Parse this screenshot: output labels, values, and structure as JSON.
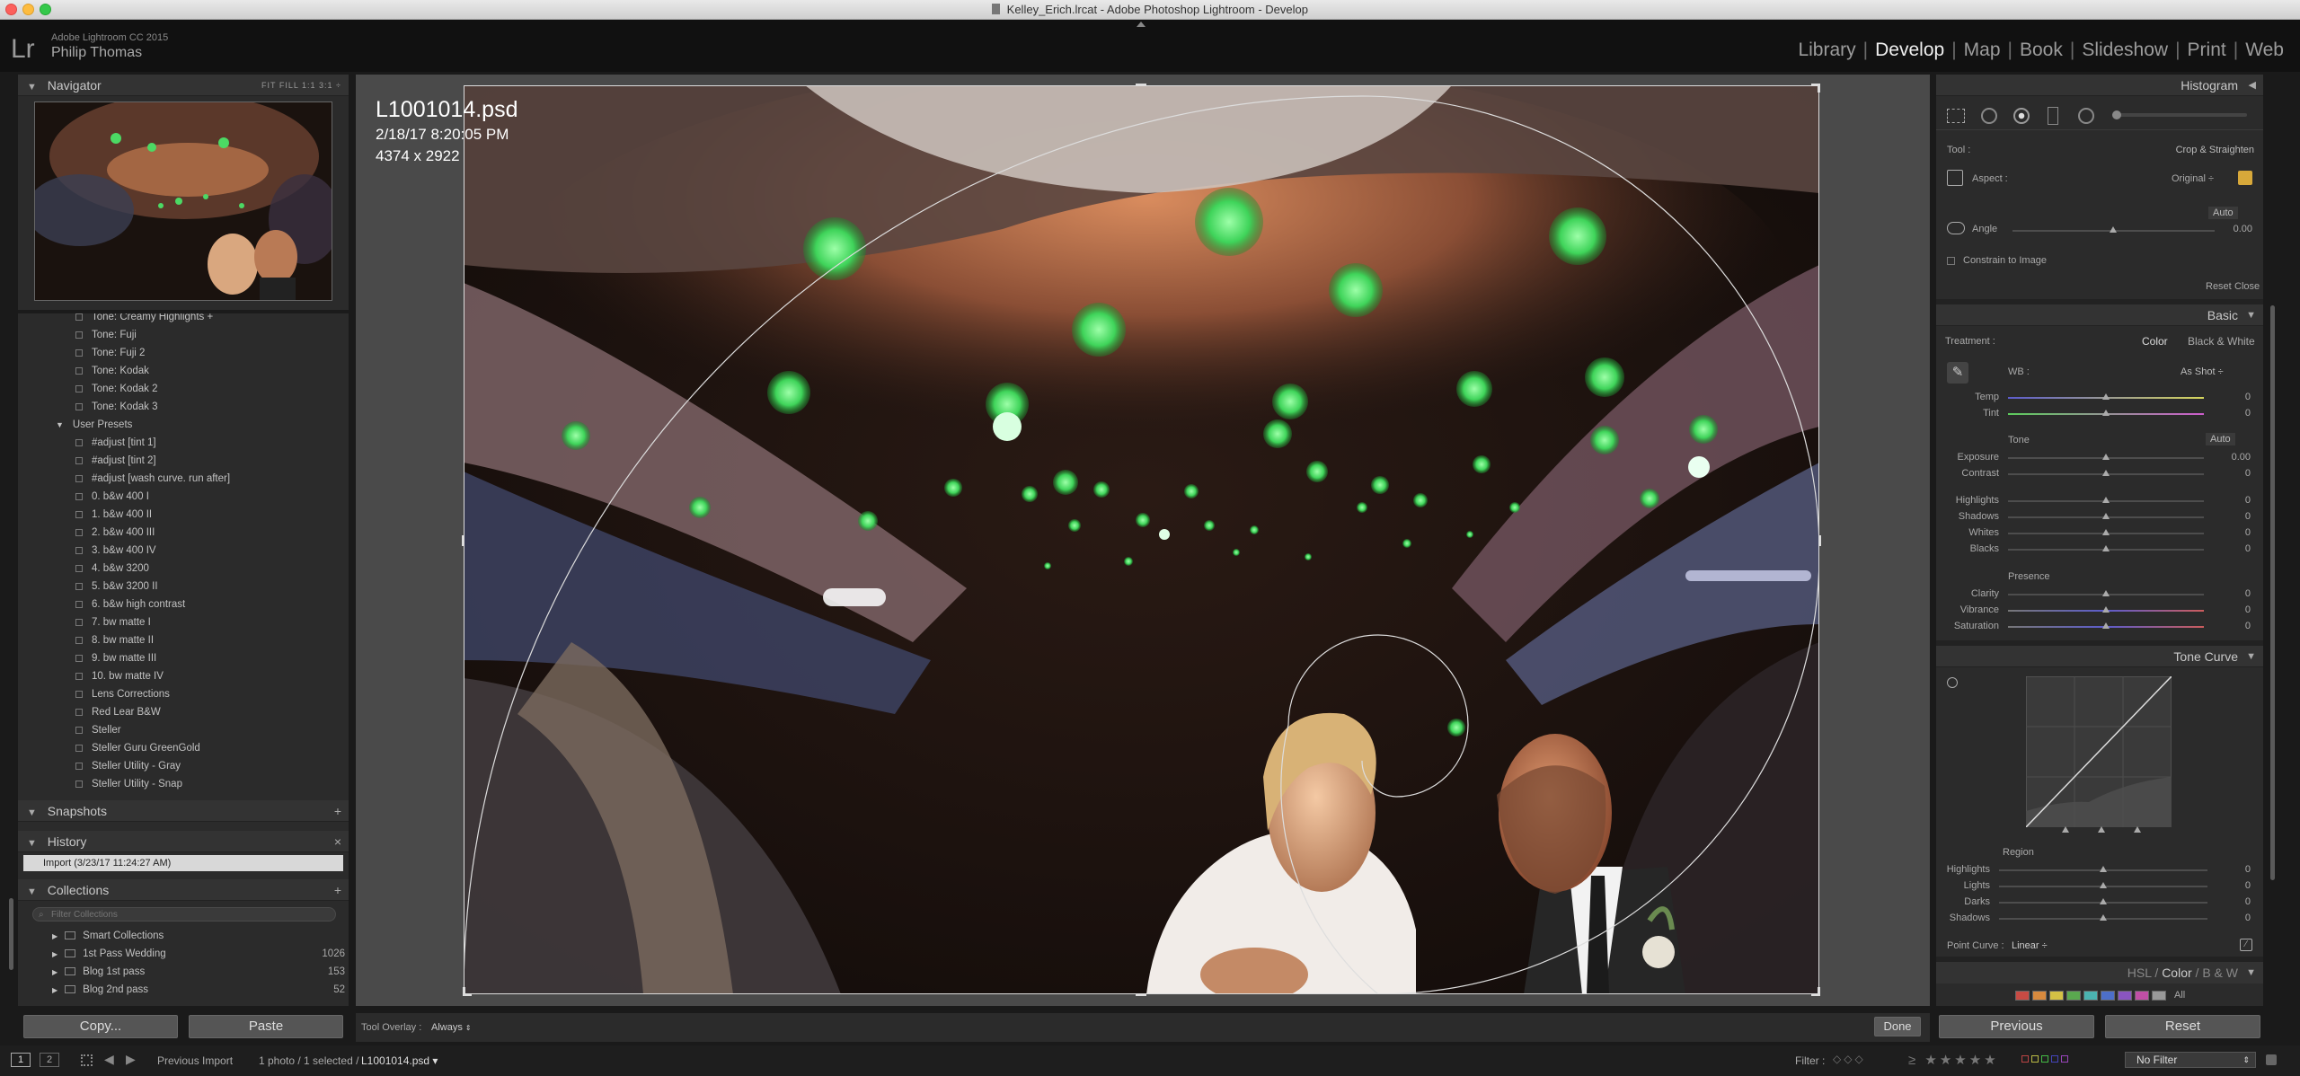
{
  "window": {
    "title": "Kelley_Erich.lrcat - Adobe Photoshop Lightroom - Develop"
  },
  "identity": {
    "logo": "Lr",
    "app_name": "Adobe Lightroom CC 2015",
    "user": "Philip Thomas"
  },
  "modules": [
    {
      "label": "Library",
      "active": false
    },
    {
      "label": "Develop",
      "active": true
    },
    {
      "label": "Map",
      "active": false
    },
    {
      "label": "Book",
      "active": false
    },
    {
      "label": "Slideshow",
      "active": false
    },
    {
      "label": "Print",
      "active": false
    },
    {
      "label": "Web",
      "active": false
    }
  ],
  "navigator": {
    "title": "Navigator",
    "modes": "FIT  FILL  1:1  3:1 ÷"
  },
  "presets": {
    "items": [
      "Tone: Creamy Highlights +",
      "Tone: Fuji",
      "Tone: Fuji 2",
      "Tone: Kodak",
      "Tone: Kodak 2",
      "Tone: Kodak 3"
    ],
    "user_folder": "User Presets",
    "user_items": [
      "#adjust [tint 1]",
      "#adjust [tint 2]",
      "#adjust [wash curve. run after]",
      "0. b&w 400 I",
      "1. b&w 400 II",
      "2. b&w 400 III",
      "3. b&w 400 IV",
      "4. b&w 3200",
      "5. b&w 3200 II",
      "6. b&w high contrast",
      "7. bw matte I",
      "8. bw matte II",
      "9. bw matte III",
      "10. bw matte IV",
      "Lens Corrections",
      "Red Lear B&W",
      "Steller",
      "Steller Guru GreenGold",
      "Steller Utility - Gray",
      "Steller Utility - Snap"
    ]
  },
  "snapshots": {
    "title": "Snapshots",
    "action": "+"
  },
  "history": {
    "title": "History",
    "action": "×",
    "items": [
      "Import (3/23/17 11:24:27 AM)"
    ]
  },
  "collections": {
    "title": "Collections",
    "action": "+",
    "filter_placeholder": "Filter Collections",
    "items": [
      {
        "label": "Smart Collections",
        "count": ""
      },
      {
        "label": "1st Pass Wedding",
        "count": "1026"
      },
      {
        "label": "Blog 1st pass",
        "count": "153"
      },
      {
        "label": "Blog 2nd pass",
        "count": "52"
      }
    ]
  },
  "left_buttons": {
    "copy": "Copy...",
    "paste": "Paste"
  },
  "photo_info": {
    "filename": "L1001014.psd",
    "datetime": "2/18/17 8:20:05 PM",
    "dimensions": "4374 x 2922"
  },
  "toolbar": {
    "overlay_label": "Tool Overlay :",
    "overlay_value": "Always",
    "done": "Done"
  },
  "histogram": {
    "title": "Histogram"
  },
  "crop_tool": {
    "tool_label": "Tool :",
    "tool_value": "Crop & Straighten",
    "aspect_label": "Aspect :",
    "aspect_value": "Original",
    "auto": "Auto",
    "angle_label": "Angle",
    "angle_value": "0.00",
    "constrain": "Constrain to Image",
    "reset": "Reset",
    "close": "Close"
  },
  "basic": {
    "title": "Basic",
    "treatment_label": "Treatment :",
    "treatment_color": "Color",
    "treatment_bw": "Black & White",
    "wb_label": "WB :",
    "wb_value": "As Shot",
    "temp": {
      "label": "Temp",
      "value": "0"
    },
    "tint": {
      "label": "Tint",
      "value": "0"
    },
    "tone_label": "Tone",
    "tone_auto": "Auto",
    "tone_sliders": [
      {
        "label": "Exposure",
        "value": "0.00"
      },
      {
        "label": "Contrast",
        "value": "0"
      },
      {
        "label": "Highlights",
        "value": "0"
      },
      {
        "label": "Shadows",
        "value": "0"
      },
      {
        "label": "Whites",
        "value": "0"
      },
      {
        "label": "Blacks",
        "value": "0"
      }
    ],
    "presence_label": "Presence",
    "presence_sliders": [
      {
        "label": "Clarity",
        "value": "0"
      },
      {
        "label": "Vibrance",
        "value": "0"
      },
      {
        "label": "Saturation",
        "value": "0"
      }
    ]
  },
  "tone_curve": {
    "title": "Tone Curve",
    "region_label": "Region",
    "sliders": [
      {
        "label": "Highlights",
        "value": "0"
      },
      {
        "label": "Lights",
        "value": "0"
      },
      {
        "label": "Darks",
        "value": "0"
      },
      {
        "label": "Shadows",
        "value": "0"
      }
    ],
    "point_curve_label": "Point Curve :",
    "point_curve_value": "Linear"
  },
  "hsl": {
    "label_hsl": "HSL",
    "label_color": "Color",
    "label_bw": "B & W",
    "all": "All"
  },
  "right_buttons": {
    "previous": "Previous",
    "reset": "Reset"
  },
  "filmstrip": {
    "page1": "1",
    "page2": "2",
    "source": "Previous Import",
    "count": "1 photo / 1 selected /",
    "file": "L1001014.psd",
    "filter_label": "Filter :",
    "filter_value": "No Filter"
  }
}
